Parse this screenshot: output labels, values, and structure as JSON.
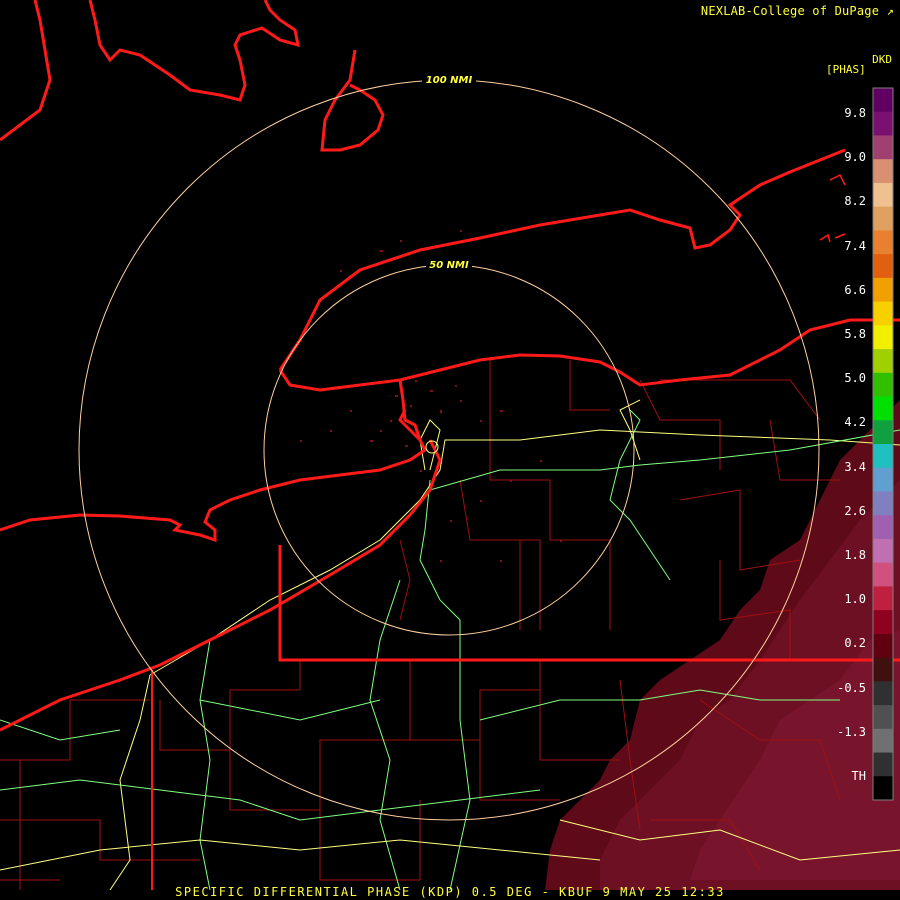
{
  "header": {
    "credit": "NEXLAB-College of DuPage"
  },
  "legend": {
    "product_code": "DKD",
    "units": "[PHAS]",
    "labels": [
      "9.8",
      "9.0",
      "8.2",
      "7.4",
      "6.6",
      "5.8",
      "5.0",
      "4.2",
      "3.4",
      "2.6",
      "1.8",
      "1.0",
      "0.2",
      "-0.5",
      "-1.3",
      "TH"
    ],
    "colors": [
      "#600060",
      "#7a1070",
      "#a04070",
      "#d89070",
      "#f0c090",
      "#e0a060",
      "#e88030",
      "#e06010",
      "#f0a000",
      "#f8d000",
      "#f0f000",
      "#a0d000",
      "#30c000",
      "#00e000",
      "#10a040",
      "#20c0c0",
      "#60a0d0",
      "#8080c0",
      "#a060b0",
      "#c070b0",
      "#d05080",
      "#c02040",
      "#900020",
      "#600010",
      "#401010",
      "#303030",
      "#505050",
      "#707070",
      "#303030",
      "#000000"
    ]
  },
  "range_rings": [
    {
      "label": "100 NMI"
    },
    {
      "label": "50 NMI"
    }
  ],
  "map": {
    "state_border_color": "#ff1a1a",
    "county_line_color": "#a01010",
    "highway_color_major": "#ffff80",
    "highway_color_minor": "#80ff80",
    "ring_color": "#ffd0a0",
    "echo_color": "#6a0a1e"
  },
  "footer": {
    "title": "SPECIFIC DIFFERENTIAL PHASE (KDP) 0.5 DEG - KBUF 9 MAY 25 12:33"
  }
}
